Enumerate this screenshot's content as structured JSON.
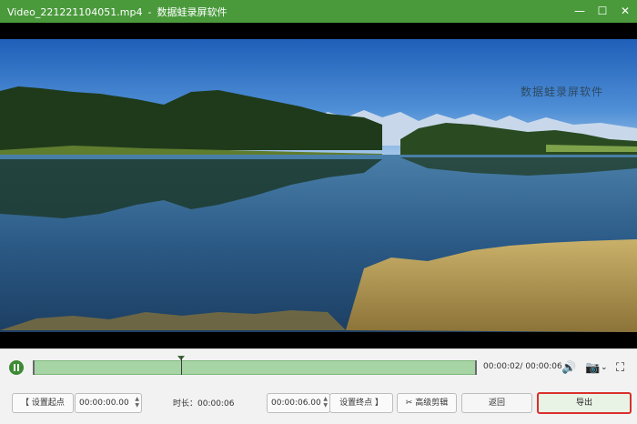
{
  "window": {
    "file_name": "Video_221221104051.mp4",
    "separator": "-",
    "app_name": "数据蛙录屏软件",
    "min_glyph": "—",
    "max_glyph": "☐",
    "close_glyph": "✕"
  },
  "video": {
    "watermark": "数据蛙录屏软件"
  },
  "player": {
    "state": "paused",
    "progress": 0.333,
    "time_display": "00:00:02/ 00:00:06",
    "volume_glyph": "🔊",
    "camera_glyph": "📷",
    "chevron_glyph": "⌄",
    "fullscreen_glyph": "⛶"
  },
  "edit": {
    "set_start_label": "【 设置起点",
    "start_time": "00:00:00.00",
    "duration_label": "时长：00:00:06",
    "end_time": "00:00:06.00",
    "set_end_label": "设置终点 】",
    "advanced_label": "高级剪辑",
    "back_label": "返回",
    "export_label": "导出"
  },
  "colors": {
    "title_bar": "#4a9a3c",
    "accent_green": "#3e8a34",
    "timeline_fill": "#a6d4a4",
    "highlight_red": "#d9302c"
  }
}
